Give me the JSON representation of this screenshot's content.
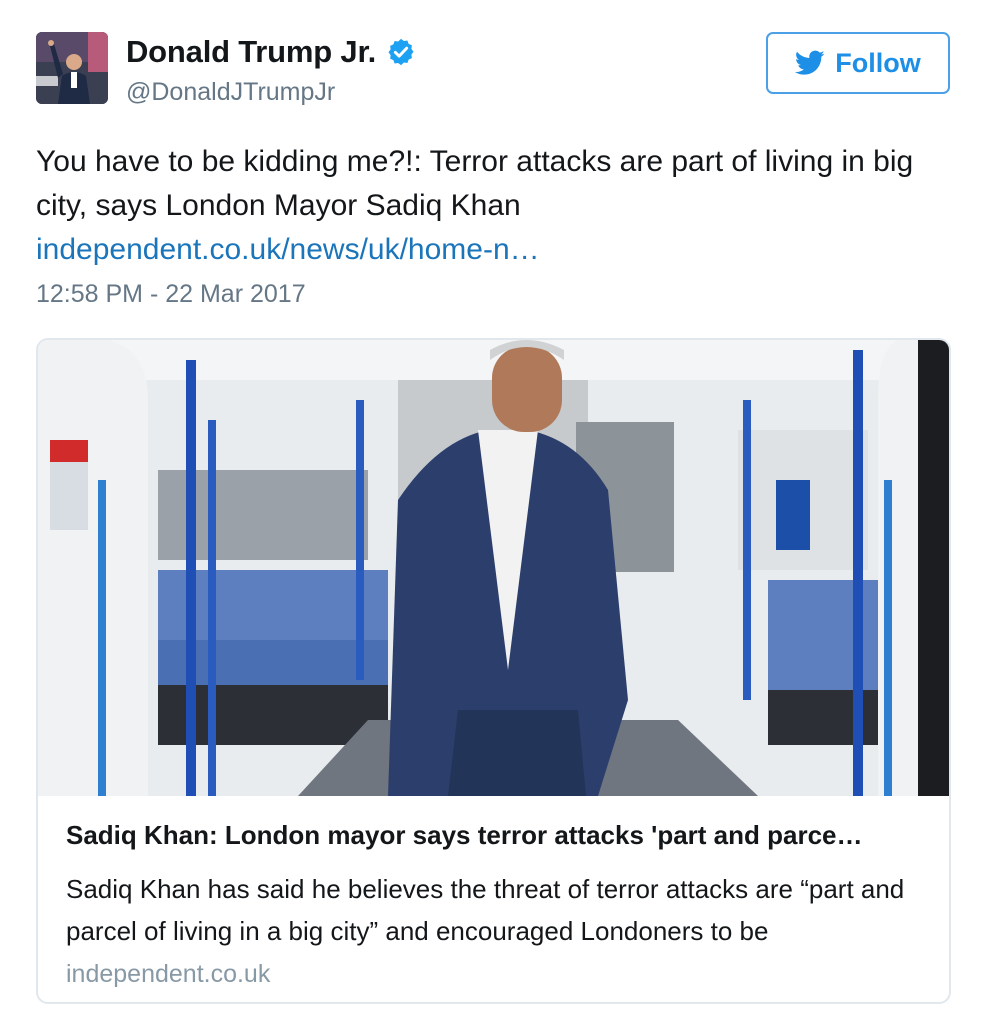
{
  "user": {
    "display_name": "Donald Trump Jr.",
    "handle": "@DonaldJTrumpJr",
    "verified": true
  },
  "follow_button": {
    "label": "Follow",
    "icon": "twitter-bird-icon"
  },
  "tweet": {
    "text": "You have to be kidding me?!: Terror attacks are part of living in big city, says London Mayor Sadiq Khan",
    "link": "independent.co.uk/news/uk/home-n…",
    "timestamp": "12:58 PM - 22 Mar 2017"
  },
  "card": {
    "title": "Sadiq Khan: London mayor says terror attacks 'part and parce…",
    "description": "Sadiq Khan has said he believes the threat of terror attacks are “part and parcel of living in a big city” and encouraged Londoners to be",
    "domain": "independent.co.uk"
  },
  "colors": {
    "accent": "#1d8fe6",
    "link": "#1b75bb",
    "muted": "#657786",
    "verified": "#1da1f2"
  }
}
